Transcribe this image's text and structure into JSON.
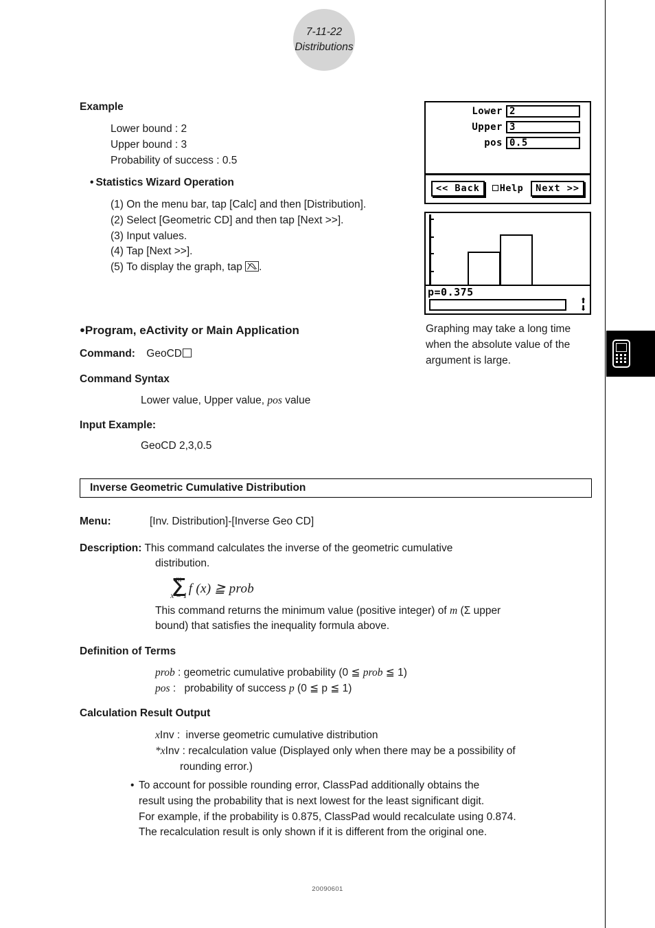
{
  "header": {
    "page_number": "7-11-22",
    "chapter": "Distributions"
  },
  "example": {
    "heading": "Example",
    "lines": [
      "Lower bound : 2",
      "Upper bound : 3",
      "Probability of success : 0.5"
    ]
  },
  "wizard_section": {
    "heading": "Statistics Wizard Operation",
    "bullet": "•",
    "steps": [
      "(1) On the menu bar, tap [Calc] and then [Distribution].",
      "(2) Select [Geometric CD] and then tap [Next >>].",
      "(3) Input values.",
      "(4) Tap [Next >>].",
      "(5) To display the graph, tap"
    ],
    "step5_tail": "."
  },
  "calc_wizard": {
    "rows": [
      {
        "label": "Lower",
        "value": "2"
      },
      {
        "label": "Upper",
        "value": "3"
      },
      {
        "label": "pos",
        "value": "0.5"
      }
    ],
    "back_button": "<< Back",
    "help_label": "Help",
    "next_button": "Next >>"
  },
  "calc_graph": {
    "readout": "p=0.375",
    "scroll_up": "⬆",
    "scroll_down": "⬇"
  },
  "shot_caption": "Graphing may take a long time when the absolute value of the argument is large.",
  "program_section": {
    "bullet": "●",
    "heading": "Program, eActivity or Main Application",
    "command_label": "Command:",
    "command_value": "GeoCD",
    "syntax_heading": "Command Syntax",
    "syntax_pre": "Lower value, Upper value",
    "syntax_comma": ",",
    "syntax_italic": "pos",
    "syntax_post": "value",
    "input_example_label": "Input Example:",
    "input_example_value": "GeoCD  2,3,0.5"
  },
  "inverse_section": {
    "title": "Inverse Geometric Cumulative Distribution",
    "menu_label": "Menu:",
    "menu_value": "[Inv. Distribution]-[Inverse Geo CD]",
    "description_label": "Description:",
    "description_line1": "This command calculates the inverse of the geometric cumulative",
    "description_line2": "distribution.",
    "formula": {
      "sigma": "Σ",
      "upper_limit": "m",
      "lower_limit": "x = 1",
      "body": "f (x) ≧ prob"
    },
    "returns_line1_pre": "This command returns the minimum value (positive integer) of",
    "returns_italic_m": "m",
    "returns_line1_post": "(Σ upper",
    "returns_line2": "bound) that satisfies the inequality formula above."
  },
  "definition_of_terms": {
    "heading": "Definition of Terms",
    "items": [
      {
        "term": "prob",
        "sep": ":",
        "text_pre": "geometric cumulative probability (0 ≦",
        "text_italic": "prob",
        "text_post": "≦ 1)"
      },
      {
        "term": "pos",
        "sep": ":",
        "text_pre": "probability of success",
        "text_italic": "p",
        "text_post": "(0 ≦ p ≦ 1)"
      }
    ]
  },
  "calculation_result_output": {
    "heading": "Calculation Result Output",
    "rows": [
      {
        "italic": "x",
        "name": "Inv :",
        "text": "inverse geometric cumulative distribution"
      },
      {
        "italic": "*x",
        "name": "Inv :",
        "text": "recalculation value (Displayed only when there may be a possibility of"
      }
    ],
    "row2_cont": "rounding error.)",
    "note_bullet": "•",
    "note_lines": [
      "To account for possible rounding error, ClassPad additionally obtains the",
      "result using the probability that is next lowest for the least significant digit.",
      "For example, if the probability is 0.875, ClassPad would recalculate using 0.874.",
      "The recalculation result is only shown if it is different from the original one."
    ]
  },
  "index_tab": {
    "icon": "calculator-icon"
  },
  "footer": {
    "document_code": "20090601"
  }
}
